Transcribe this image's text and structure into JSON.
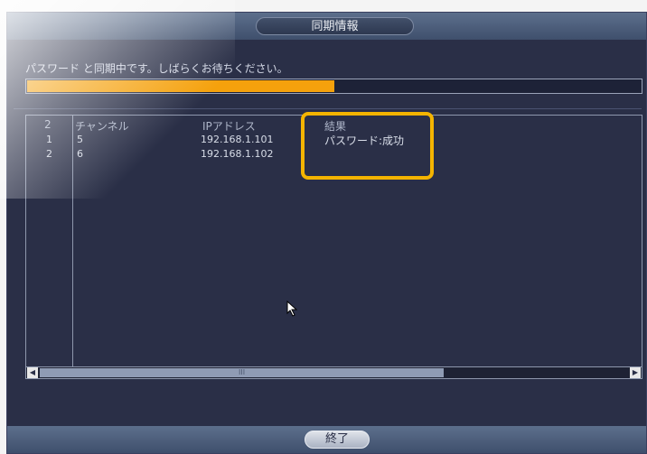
{
  "dialog": {
    "title": "同期情報"
  },
  "sync": {
    "message": "パスワード と同期中です。しばらくお待ちください。",
    "progress": 0.5
  },
  "table": {
    "count_header": "2",
    "columns": [
      "チャンネル",
      "IPアドレス",
      "結果"
    ],
    "rows": [
      {
        "no": "1",
        "channel": "5",
        "ip": "192.168.1.101",
        "result": "パスワード:成功"
      },
      {
        "no": "2",
        "channel": "6",
        "ip": "192.168.1.102",
        "result": ""
      }
    ],
    "scroll_grip": "III"
  },
  "footer": {
    "end_label": "終了"
  },
  "colors": {
    "accent": "#f5a10c",
    "highlight": "#f4b400",
    "background": "#2a2f47"
  }
}
